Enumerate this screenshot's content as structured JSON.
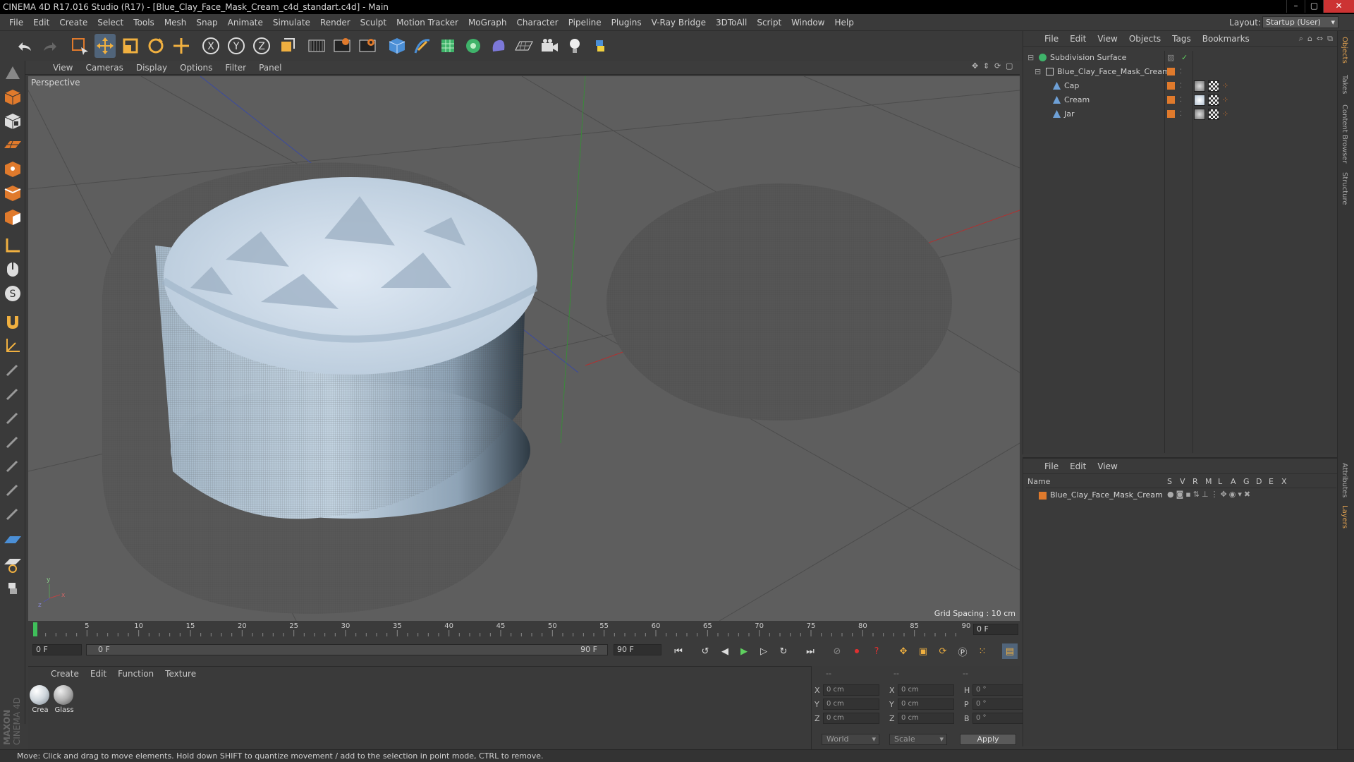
{
  "window": {
    "title": "CINEMA 4D R17.016 Studio (R17) - [Blue_Clay_Face_Mask_Cream_c4d_standart.c4d] - Main",
    "buttons": {
      "minimize": "–",
      "maximize": "▢",
      "close": "✕"
    }
  },
  "menu": [
    "File",
    "Edit",
    "Create",
    "Select",
    "Tools",
    "Mesh",
    "Snap",
    "Animate",
    "Simulate",
    "Render",
    "Sculpt",
    "Motion Tracker",
    "MoGraph",
    "Character",
    "Pipeline",
    "Plugins",
    "V-Ray Bridge",
    "3DToAll",
    "Script",
    "Window",
    "Help"
  ],
  "layout": {
    "label": "Layout:",
    "value": "Startup (User)"
  },
  "toolbar": {
    "icons": [
      "undo-icon",
      "redo-icon",
      "live-selection-icon",
      "move-icon",
      "scale-icon",
      "rotate-icon",
      "add-object-icon",
      "x-axis-icon",
      "y-axis-icon",
      "z-axis-icon",
      "coordinate-system-icon",
      "render-view-icon",
      "render-picture-viewer-icon",
      "edit-render-settings-icon",
      "cube-icon",
      "pen-icon",
      "subdivision-icon",
      "array-icon",
      "deformer-icon",
      "floor-icon",
      "camera-icon",
      "light-icon",
      "python-icon"
    ],
    "axis_labels": [
      "X",
      "Y",
      "Z"
    ]
  },
  "viewport": {
    "menu": [
      "View",
      "Cameras",
      "Display",
      "Options",
      "Filter",
      "Panel"
    ],
    "label": "Perspective",
    "grid_spacing": "Grid Spacing : 10 cm",
    "axis_letters": {
      "x": "x",
      "y": "y",
      "z": "z"
    }
  },
  "timeline": {
    "ticks": [
      "0",
      "5",
      "10",
      "15",
      "20",
      "25",
      "30",
      "35",
      "40",
      "45",
      "50",
      "55",
      "60",
      "65",
      "70",
      "75",
      "80",
      "85",
      "90"
    ],
    "current_frame": "0 F",
    "start_field": "0 F",
    "range_start": "0 F",
    "range_end": "90 F",
    "end_field": "90 F"
  },
  "materials": {
    "menu": [
      "Create",
      "Edit",
      "Function",
      "Texture"
    ],
    "items": [
      {
        "label": "Crea",
        "color": "#cfd6dc"
      },
      {
        "label": "Glass",
        "color": "#b0b0b0"
      }
    ]
  },
  "coordinates": {
    "headers": [
      "--",
      "--",
      "--"
    ],
    "rows": [
      {
        "a1": "X",
        "v1": "0 cm",
        "a2": "X",
        "v2": "0 cm",
        "a3": "H",
        "v3": "0 °"
      },
      {
        "a1": "Y",
        "v1": "0 cm",
        "a2": "Y",
        "v2": "0 cm",
        "a3": "P",
        "v3": "0 °"
      },
      {
        "a1": "Z",
        "v1": "0 cm",
        "a2": "Z",
        "v2": "0 cm",
        "a3": "B",
        "v3": "0 °"
      }
    ],
    "mode": "World",
    "transform": "Scale",
    "apply": "Apply"
  },
  "objects_panel": {
    "menu": [
      "File",
      "Edit",
      "View",
      "Objects",
      "Tags",
      "Bookmarks"
    ],
    "items": [
      {
        "name": "Subdivision Surface"
      },
      {
        "name": "Blue_Clay_Face_Mask_Cream"
      },
      {
        "name": "Cap"
      },
      {
        "name": "Cream"
      },
      {
        "name": "Jar"
      }
    ]
  },
  "layers_panel": {
    "menu": [
      "File",
      "Edit",
      "View"
    ],
    "columns": [
      "Name",
      "S",
      "V",
      "R",
      "M",
      "L",
      "A",
      "G",
      "D",
      "E",
      "X"
    ],
    "rows": [
      {
        "name": "Blue_Clay_Face_Mask_Cream"
      }
    ]
  },
  "right_tabs": [
    "Objects",
    "Takes",
    "Content Browser",
    "Structure",
    "Attributes",
    "Layers"
  ],
  "brand": {
    "line1": "MAXON",
    "line2": "CINEMA 4D"
  },
  "status": "Move: Click and drag to move elements. Hold down SHIFT to quantize movement / add to the selection in point mode, CTRL to remove.",
  "colors": {
    "accent": "#e07a2c",
    "viewport_bg": "#5e5e5e",
    "panel_bg": "#3a3a3a",
    "jar_blue": "#a9bfd3"
  }
}
